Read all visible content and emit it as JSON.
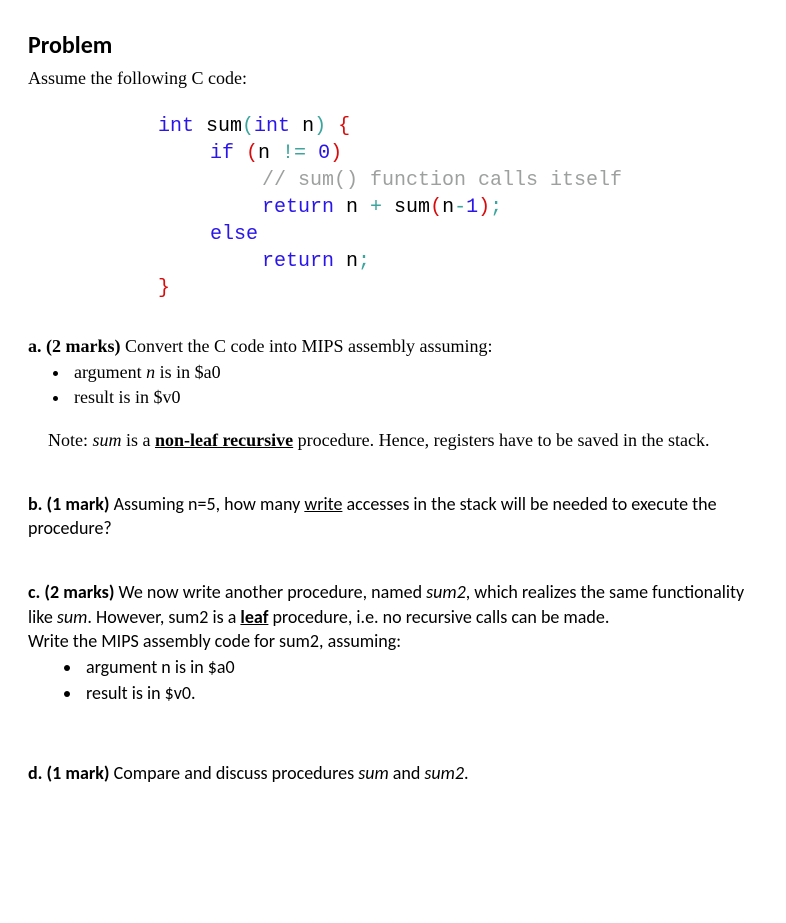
{
  "heading": "Problem",
  "intro": "Assume the following C code:",
  "code": {
    "line1_kw_int_1": "int",
    "line1_func": " sum",
    "line1_paren_open": "(",
    "line1_kw_int_2": "int",
    "line1_param": " n",
    "line1_paren_close": ")",
    "line1_brace_open": " {",
    "line2_if": "if ",
    "line2_paren_open": "(",
    "line2_cond_left": "n ",
    "line2_op": "!= ",
    "line2_zero": "0",
    "line2_paren_close": ")",
    "line3_comment": "// sum() function calls itself",
    "line4_return": "return",
    "line4_expr_left": " n ",
    "line4_plus": "+",
    "line4_sum": " sum",
    "line4_paren_open": "(",
    "line4_arg_left": "n",
    "line4_minus": "-",
    "line4_one": "1",
    "line4_paren_close": ")",
    "line4_semi": ";",
    "line5_else": "else",
    "line6_return": "return",
    "line6_var": " n",
    "line6_semi": ";",
    "line7_brace_close": "}"
  },
  "partA": {
    "label": "a.",
    "marks": "(2 marks)",
    "text": " Convert the C code into MIPS assembly assuming:",
    "bullet1_pre": "argument ",
    "bullet1_var": "n",
    "bullet1_post": " is in $a0",
    "bullet2": "result is in $v0",
    "note_pre": "Note: ",
    "note_sum": "sum",
    "note_mid": " is a ",
    "note_bold": "non-leaf recursive",
    "note_post": " procedure. Hence, registers have to be saved in the stack."
  },
  "partB": {
    "label": "b.",
    "marks": "(1 mark)",
    "text_pre": " Assuming n=5, how many ",
    "text_u": "write",
    "text_post": " accesses in the stack will be needed to execute the procedure?"
  },
  "partC": {
    "label": "c.",
    "marks": "(2 marks)",
    "text_pre": " We now write another procedure, named ",
    "text_sum2": "sum2",
    "text_mid1": ", which realizes the same functionality like ",
    "text_sum": "sum",
    "text_mid2": ". However, sum2 is a ",
    "text_leaf": "leaf",
    "text_post": " procedure, i.e. no recursive calls can be made.",
    "line2": "Write the MIPS assembly code for sum2, assuming:",
    "bullet1": "argument n is in $a0",
    "bullet2": "result is in $v0."
  },
  "partD": {
    "label": "d.",
    "marks": "(1 mark)",
    "text_pre": " Compare and discuss procedures ",
    "text_sum": "sum",
    "text_and": " and ",
    "text_sum2": "sum2",
    "text_end": "."
  }
}
